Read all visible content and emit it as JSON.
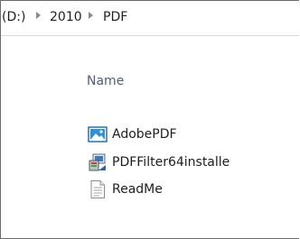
{
  "breadcrumb": [
    "(D:)",
    "2010",
    "PDF"
  ],
  "file_list": {
    "column_header": "Name",
    "items": [
      {
        "label": "AdobePDF",
        "icon": "image-file-icon"
      },
      {
        "label": "PDFFilter64installe",
        "icon": "installer-icon"
      },
      {
        "label": "ReadMe",
        "icon": "text-file-icon"
      }
    ]
  }
}
